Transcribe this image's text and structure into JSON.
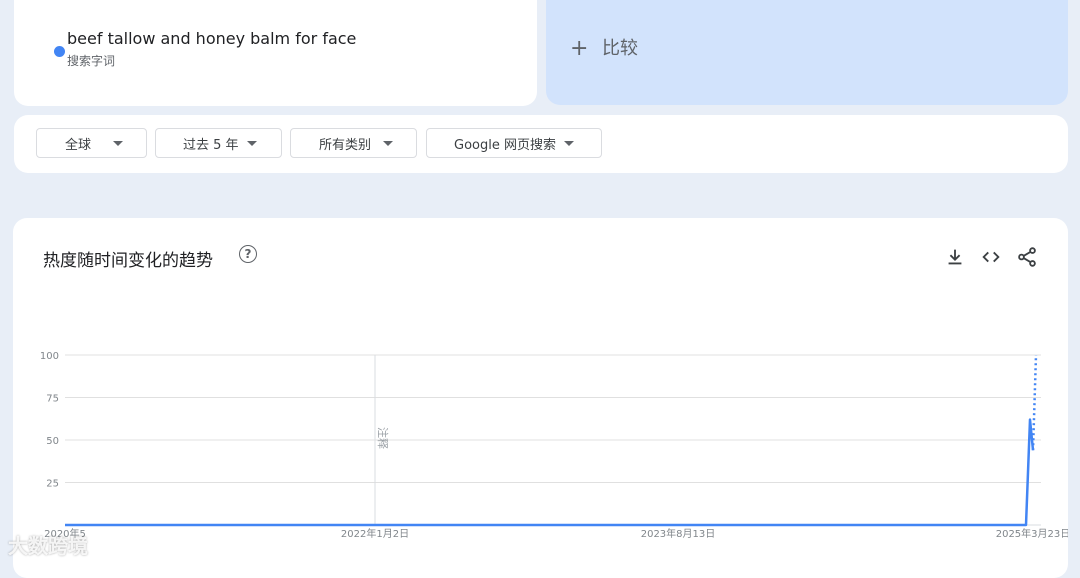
{
  "search_term": {
    "name": "beef tallow and honey balm for face",
    "type": "搜索字词",
    "color": "#4285f4"
  },
  "compare": {
    "icon": "plus-icon",
    "label": "比较"
  },
  "filters": [
    {
      "label": "全球"
    },
    {
      "label": "过去 5 年"
    },
    {
      "label": "所有类别"
    },
    {
      "label": "Google 网页搜索"
    }
  ],
  "chart_section": {
    "title": "热度随时间变化的趋势",
    "help_icon": "help-circle-icon",
    "tools": [
      "download-icon",
      "embed-code-icon",
      "share-icon"
    ]
  },
  "chart_data": {
    "type": "line",
    "title": "",
    "ylim": [
      0,
      100
    ],
    "yticks": [
      "100",
      "75",
      "50",
      "25"
    ],
    "xticks": [
      "2020年5",
      "2022年1月2日",
      "2023年8月13日",
      "2025年3月23日"
    ],
    "annotation": "注释",
    "series": [
      {
        "color": "#4285f4",
        "points": [
          [
            "2020年5",
            0
          ],
          [
            "2022年1月2日",
            0
          ],
          [
            "2023年8月13日",
            0
          ],
          [
            "2025年3月23日",
            0
          ],
          [
            "peak",
            62
          ],
          [
            "end",
            44
          ]
        ],
        "partial_end": 100
      }
    ],
    "grid": true
  },
  "watermark": "大数跨境"
}
